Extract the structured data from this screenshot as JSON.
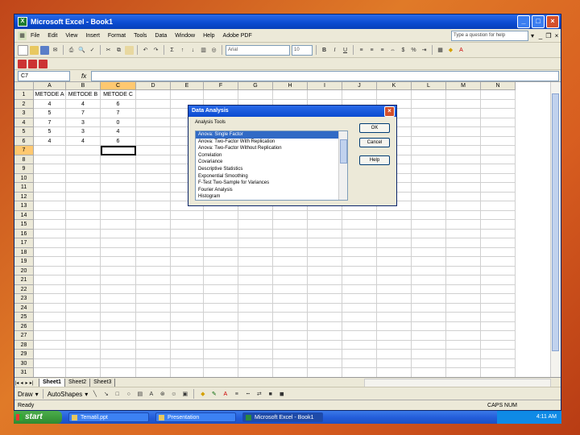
{
  "window": {
    "title": "Microsoft Excel - Book1"
  },
  "menu": {
    "items": [
      "File",
      "Edit",
      "View",
      "Insert",
      "Format",
      "Tools",
      "Data",
      "Window",
      "Help",
      "Adobe PDF"
    ],
    "help_placeholder": "Type a question for help"
  },
  "toolbar": {
    "font_name": "Arial",
    "font_size": "10"
  },
  "formula": {
    "name_box": "C7",
    "fx": "fx"
  },
  "sheet": {
    "columns": [
      "A",
      "B",
      "C",
      "D",
      "E",
      "F",
      "G",
      "H",
      "I",
      "J",
      "K",
      "L",
      "M",
      "N"
    ],
    "rows": [
      "1",
      "2",
      "3",
      "4",
      "5",
      "6",
      "7",
      "8",
      "9",
      "10",
      "11",
      "12",
      "13",
      "14",
      "15",
      "16",
      "17",
      "18",
      "19",
      "20",
      "21",
      "22",
      "23",
      "24",
      "25",
      "26",
      "27",
      "28",
      "29",
      "30",
      "31"
    ],
    "data": [
      [
        "METODE A",
        "METODE B",
        "METODE C"
      ],
      [
        "4",
        "4",
        "6"
      ],
      [
        "5",
        "7",
        "7"
      ],
      [
        "7",
        "3",
        "0"
      ],
      [
        "5",
        "3",
        "4"
      ],
      [
        "4",
        "4",
        "6"
      ]
    ],
    "tabs": [
      "Sheet1",
      "Sheet2",
      "Sheet3"
    ]
  },
  "dialog": {
    "title": "Data Analysis",
    "tools_label": "Analysis Tools",
    "tools": [
      "Anova: Single Factor",
      "Anova: Two-Factor With Replication",
      "Anova: Two-Factor Without Replication",
      "Correlation",
      "Covariance",
      "Descriptive Statistics",
      "Exponential Smoothing",
      "F-Test Two-Sample for Variances",
      "Fourier Analysis",
      "Histogram"
    ],
    "selected_index": 0,
    "ok": "OK",
    "cancel": "Cancel",
    "help": "Help"
  },
  "drawbar": {
    "draw": "Draw",
    "autoshapes": "AutoShapes"
  },
  "status": {
    "left": "Ready",
    "caps": "CAPS NUM"
  },
  "taskbar": {
    "start": "start",
    "tasks": [
      "Tematil.ppt",
      "Presentation",
      "Microsoft Excel - Book1"
    ],
    "clock": "4:11 AM"
  }
}
